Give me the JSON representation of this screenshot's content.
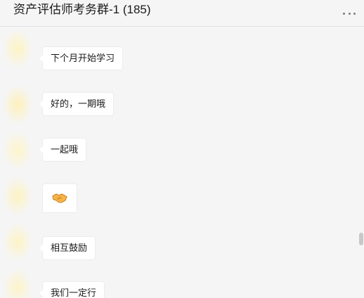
{
  "header": {
    "title": "资产评估师考务群-1 (185)",
    "more_icon": "more-horizontal-icon"
  },
  "messages": [
    {
      "type": "text",
      "text": "下个月开始学习"
    },
    {
      "type": "text",
      "text": "好的，一期哦"
    },
    {
      "type": "text",
      "text": "一起哦"
    },
    {
      "type": "sticker",
      "icon": "handshake-icon"
    },
    {
      "type": "text",
      "text": "相互鼓励"
    },
    {
      "type": "text",
      "text": "我们一定行"
    }
  ],
  "colors": {
    "background": "#f5f5f5",
    "bubble": "#ffffff",
    "text": "#1a1a1a"
  }
}
